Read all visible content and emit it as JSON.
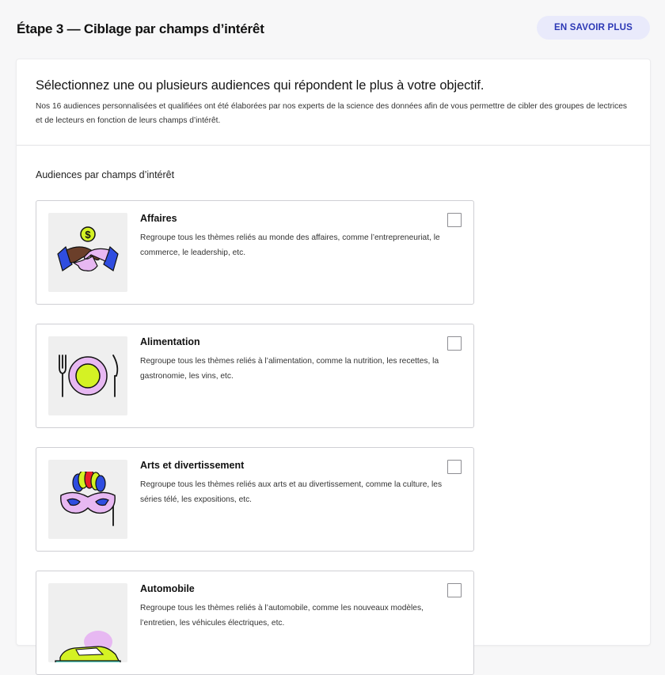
{
  "header": {
    "step_title": "Étape 3 — Ciblage par champs d’intérêt",
    "learn_more_label": "EN SAVOIR PLUS"
  },
  "intro": {
    "title": "Sélectionnez une ou plusieurs audiences qui répondent le plus à votre objectif.",
    "description": "Nos 16 audiences personnalisées et qualifiées ont été élaborées par nos experts de la science des données afin de vous permettre de cibler des groupes de lectrices et de lecteurs en fonction de leurs champs d’intérêt."
  },
  "section_label": "Audiences par champs d’intérêt",
  "cards": [
    {
      "title": "Affaires",
      "description": "Regroupe tous les thèmes reliés au monde des affaires, comme l’entrepreneuriat, le commerce, le leadership, etc.",
      "icon": "handshake-dollar-icon",
      "checked": false
    },
    {
      "title": "Alimentation",
      "description": "Regroupe tous les thèmes reliés à l’alimentation, comme la nutrition, les recettes, la gastronomie, les vins, etc.",
      "icon": "plate-cutlery-icon",
      "checked": false
    },
    {
      "title": "Arts et divertissement",
      "description": "Regroupe tous les thèmes reliés aux arts et au divertissement, comme la culture, les séries télé, les expositions, etc.",
      "icon": "carnival-mask-icon",
      "checked": false
    },
    {
      "title": "Automobile",
      "description": "Regroupe tous les thèmes reliés à l’automobile, comme les nouveaux modèles, l’entretien, les véhicules électriques, etc.",
      "icon": "car-icon",
      "checked": false
    }
  ],
  "colors": {
    "accent": "#2b37b5",
    "accent_bg": "#e9eafb",
    "lime": "#d4f224",
    "lilac": "#e7b8f2",
    "blue": "#2f4de0"
  }
}
